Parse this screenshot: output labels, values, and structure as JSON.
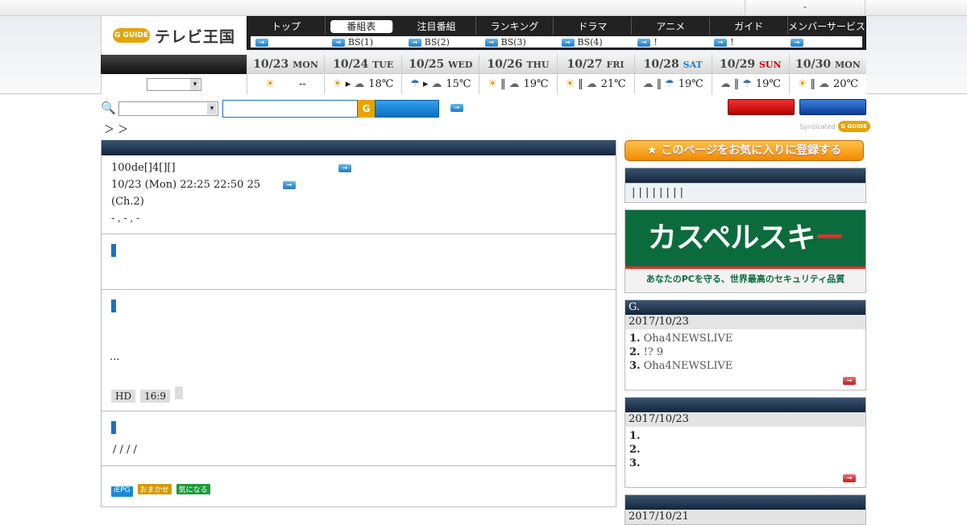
{
  "topbar": {
    "member_text": "-"
  },
  "logo": {
    "g_mark": "G GUIDE",
    "name": "テレビ王国"
  },
  "nav": {
    "menu": [
      "トップ",
      "番組表",
      "注目番組",
      "ランキング",
      "ドラマ",
      "アニメ",
      "ガイド",
      "メンバーサービス"
    ],
    "active_index": 1,
    "sub": [
      "",
      "BS(1)",
      "BS(2)",
      "BS(3)",
      "BS(4)",
      "!",
      "!",
      ""
    ]
  },
  "days": [
    {
      "date": "10/23",
      "wd": "MON",
      "wclass": "",
      "w1": "sun",
      "w2": "",
      "sep": "",
      "temp": "--"
    },
    {
      "date": "10/24",
      "wd": "TUE",
      "wclass": "",
      "w1": "sun",
      "w2": "cloud",
      "sep": "▸",
      "temp": "18℃"
    },
    {
      "date": "10/25",
      "wd": "WED",
      "wclass": "",
      "w1": "umbrella",
      "w2": "cloud",
      "sep": "▸",
      "temp": "15℃"
    },
    {
      "date": "10/26",
      "wd": "THU",
      "wclass": "",
      "w1": "sun",
      "w2": "cloud",
      "sep": "‖",
      "temp": "19℃"
    },
    {
      "date": "10/27",
      "wd": "FRI",
      "wclass": "",
      "w1": "sun",
      "w2": "cloud",
      "sep": "‖",
      "temp": "21℃"
    },
    {
      "date": "10/28",
      "wd": "SAT",
      "wclass": "sat",
      "w1": "cloud",
      "w2": "umbrella",
      "sep": "‖",
      "temp": "19℃"
    },
    {
      "date": "10/29",
      "wd": "SUN",
      "wclass": "sun",
      "w1": "cloud",
      "w2": "umbrella",
      "sep": "‖",
      "temp": "19℃"
    },
    {
      "date": "10/30",
      "wd": "MON",
      "wclass": "",
      "w1": "sun",
      "w2": "cloud",
      "sep": "‖",
      "temp": "20℃"
    }
  ],
  "breadcrumb": "＞ ＞",
  "syndicated": {
    "label": "Syndicated",
    "mark": "G GUIDE"
  },
  "program": {
    "title": "100de[]4[][]",
    "datetime": "10/23 (Mon) 22:25  22:50 25",
    "channel": "(Ch.2)",
    "cast": "-    ,  -     ,  -",
    "ellipsis": "...",
    "tags": [
      "HD",
      "16:9",
      ""
    ],
    "genre": "/ / / /",
    "badges": [
      {
        "label": "iEPG",
        "color": "#1a8ad4"
      },
      {
        "label": "おまかせ",
        "color": "#d49a00"
      },
      {
        "label": "気になる",
        "color": "#1e9a3a"
      }
    ]
  },
  "sidebar": {
    "fav_button": "★ このページをお気に入りに登録する",
    "panel1_bars": "| | | | | | | |",
    "ad": {
      "brand": "カスペルスキ",
      "brand_dash": "ー",
      "tagline": "あなたのPCを守る、世界最高のセキュリティ品質"
    },
    "panel2": {
      "header": "G.",
      "date": "2017/10/23",
      "items": [
        {
          "n": "1.",
          "t": "Oha4NEWSLIVE"
        },
        {
          "n": "2.",
          "t": "!? 9"
        },
        {
          "n": "3.",
          "t": "Oha4NEWSLIVE"
        }
      ]
    },
    "panel3": {
      "header": "",
      "date": "2017/10/23",
      "items": [
        {
          "n": "1.",
          "t": ""
        },
        {
          "n": "2.",
          "t": ""
        },
        {
          "n": "3.",
          "t": ""
        }
      ]
    },
    "panel4": {
      "date": "2017/10/21"
    }
  },
  "colors": {
    "accent_blue": "#1a72c0",
    "nav_dark": "#222222",
    "brand_orange": "#e6a400",
    "ad_green": "#0c6b3c"
  }
}
